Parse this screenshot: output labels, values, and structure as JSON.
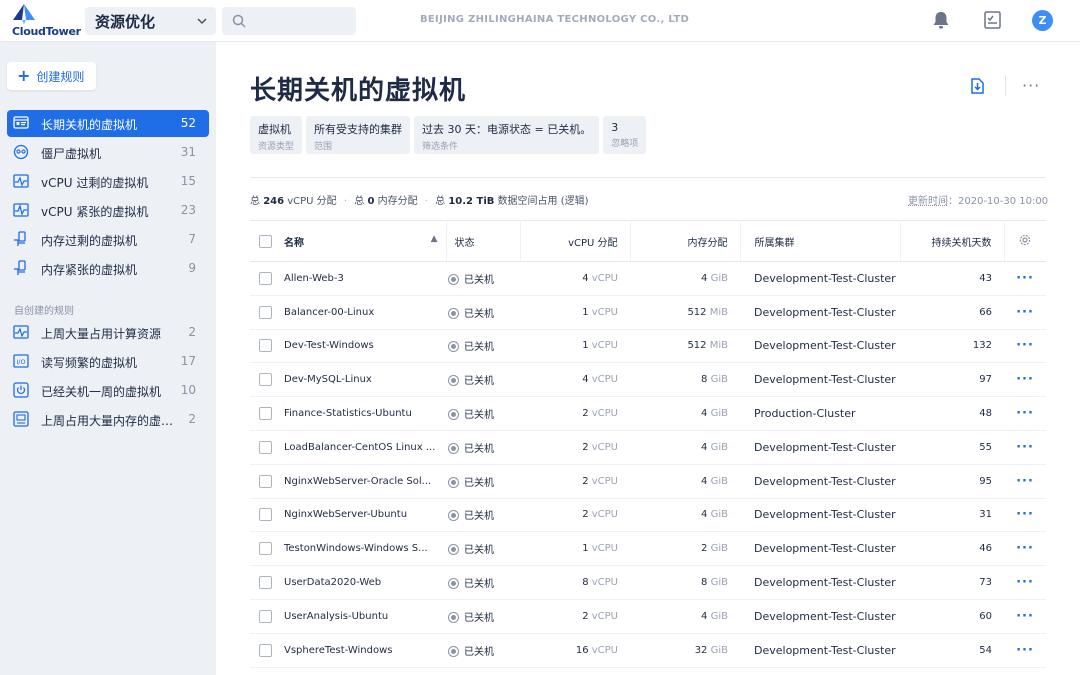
{
  "app": {
    "logo_text": "CloudTower",
    "module": "资源优化",
    "search_placeholder": "",
    "company": "BEIJING ZHILINGHAINA TECHNOLOGY CO., LTD",
    "avatar_letter": "Z"
  },
  "sidebar": {
    "create_label": "创建规则",
    "items": [
      {
        "label": "长期关机的虚拟机",
        "count": "52",
        "icon": "vm-powered-off-icon",
        "active": true
      },
      {
        "label": "僵尸虚拟机",
        "count": "31",
        "icon": "zombie-vm-icon"
      },
      {
        "label": "vCPU 过剩的虚拟机",
        "count": "15",
        "icon": "vcpu-excess-icon"
      },
      {
        "label": "vCPU 紧张的虚拟机",
        "count": "23",
        "icon": "vcpu-tight-icon"
      },
      {
        "label": "内存过剩的虚拟机",
        "count": "7",
        "icon": "memory-excess-icon"
      },
      {
        "label": "内存紧张的虚拟机",
        "count": "9",
        "icon": "memory-tight-icon"
      }
    ],
    "custom_section_label": "自创建的规则",
    "custom_items": [
      {
        "label": "上周大量占用计算资源",
        "count": "2",
        "icon": "compute-usage-icon"
      },
      {
        "label": "读写频繁的虚拟机",
        "count": "17",
        "icon": "io-icon"
      },
      {
        "label": "已经关机一周的虚拟机",
        "count": "10",
        "icon": "power-icon"
      },
      {
        "label": "上周占用大量内存的虚拟机",
        "count": "2",
        "icon": "memory-usage-icon"
      }
    ]
  },
  "main": {
    "title": "长期关机的虚拟机",
    "chips": [
      {
        "value": "虚拟机",
        "key": "资源类型"
      },
      {
        "value": "所有受支持的集群",
        "key": "范围"
      },
      {
        "value": "过去 30 天：电源状态 = 已关机。",
        "key": "筛选条件"
      },
      {
        "value": "3",
        "key": "忽略项"
      }
    ],
    "summary": {
      "prefix1": "总",
      "vcpu_total": "246",
      "vcpu_label": "vCPU 分配",
      "prefix2": "总",
      "mem_total": "0",
      "mem_label": "内存分配",
      "prefix3": "总",
      "storage_total": "10.2 TiB",
      "storage_label": "数据空间占用 (逻辑)"
    },
    "updated_label": "更新时间",
    "updated_value": "2020-10-30 10:00",
    "columns": [
      "名称",
      "状态",
      "vCPU 分配",
      "内存分配",
      "所属集群",
      "持续关机天数"
    ],
    "rows": [
      {
        "name": "Allen-Web-3",
        "status": "已关机",
        "vcpu": "4",
        "vcpu_unit": "vCPU",
        "mem": "4",
        "mem_unit": "GiB",
        "cluster": "Development-Test-Cluster",
        "days": "43"
      },
      {
        "name": "Balancer-00-Linux",
        "status": "已关机",
        "vcpu": "1",
        "vcpu_unit": "vCPU",
        "mem": "512",
        "mem_unit": "MiB",
        "cluster": "Development-Test-Cluster",
        "days": "66"
      },
      {
        "name": "Dev-Test-Windows",
        "status": "已关机",
        "vcpu": "1",
        "vcpu_unit": "vCPU",
        "mem": "512",
        "mem_unit": "MiB",
        "cluster": "Development-Test-Cluster",
        "days": "132"
      },
      {
        "name": "Dev-MySQL-Linux",
        "status": "已关机",
        "vcpu": "4",
        "vcpu_unit": "vCPU",
        "mem": "8",
        "mem_unit": "GiB",
        "cluster": "Development-Test-Cluster",
        "days": "97"
      },
      {
        "name": "Finance-Statistics-Ubuntu",
        "status": "已关机",
        "vcpu": "2",
        "vcpu_unit": "vCPU",
        "mem": "4",
        "mem_unit": "GiB",
        "cluster": "Production-Cluster",
        "days": "48"
      },
      {
        "name": "LoadBalancer-CentOS Linux ...",
        "status": "已关机",
        "vcpu": "2",
        "vcpu_unit": "vCPU",
        "mem": "4",
        "mem_unit": "GiB",
        "cluster": "Development-Test-Cluster",
        "days": "55"
      },
      {
        "name": "NginxWebServer-Oracle Sol...",
        "status": "已关机",
        "vcpu": "2",
        "vcpu_unit": "vCPU",
        "mem": "4",
        "mem_unit": "GiB",
        "cluster": "Development-Test-Cluster",
        "days": "95"
      },
      {
        "name": "NginxWebServer-Ubuntu",
        "status": "已关机",
        "vcpu": "2",
        "vcpu_unit": "vCPU",
        "mem": "4",
        "mem_unit": "GiB",
        "cluster": "Development-Test-Cluster",
        "days": "31"
      },
      {
        "name": "TestonWindows-Windows S...",
        "status": "已关机",
        "vcpu": "1",
        "vcpu_unit": "vCPU",
        "mem": "2",
        "mem_unit": "GiB",
        "cluster": "Development-Test-Cluster",
        "days": "46"
      },
      {
        "name": "UserData2020-Web",
        "status": "已关机",
        "vcpu": "8",
        "vcpu_unit": "vCPU",
        "mem": "8",
        "mem_unit": "GiB",
        "cluster": "Development-Test-Cluster",
        "days": "73"
      },
      {
        "name": "UserAnalysis-Ubuntu",
        "status": "已关机",
        "vcpu": "2",
        "vcpu_unit": "vCPU",
        "mem": "4",
        "mem_unit": "GiB",
        "cluster": "Development-Test-Cluster",
        "days": "60"
      },
      {
        "name": "VsphereTest-Windows",
        "status": "已关机",
        "vcpu": "16",
        "vcpu_unit": "vCPU",
        "mem": "32",
        "mem_unit": "GiB",
        "cluster": "Development-Test-Cluster",
        "days": "54"
      }
    ],
    "row_action": "···"
  },
  "colors": {
    "accent": "#1f6ee8",
    "sidebar_bg": "#edf0f5",
    "status_gray": "#8a93a6"
  }
}
